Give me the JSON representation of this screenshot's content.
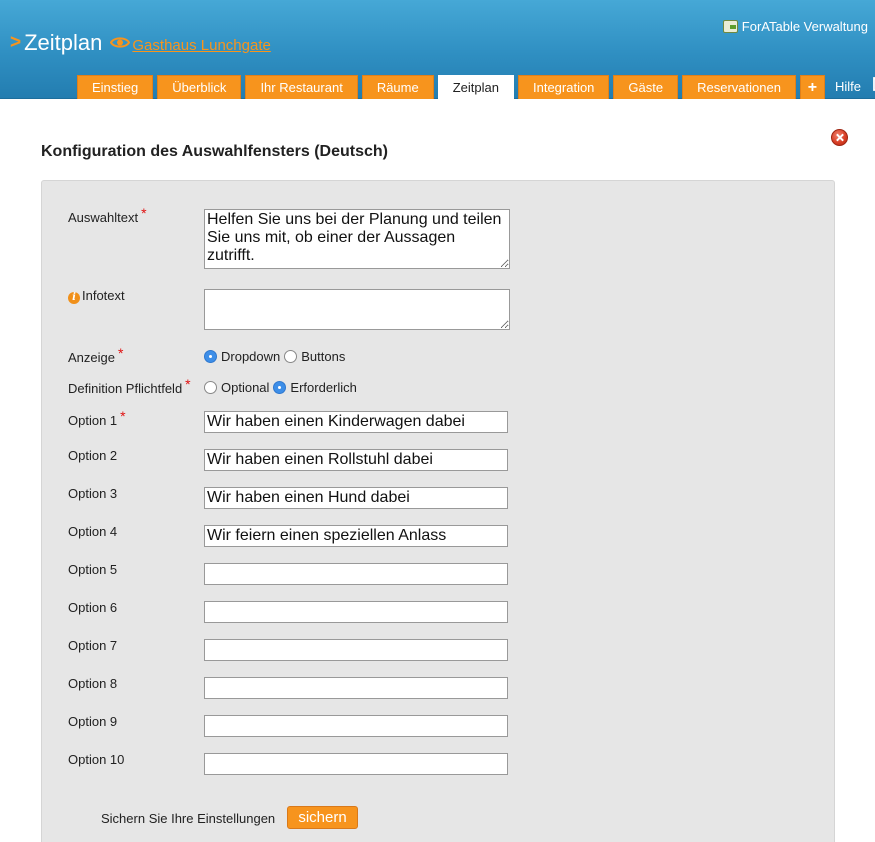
{
  "header": {
    "chevron": ">",
    "title": "Zeitplan",
    "restaurant": "Gasthaus Lunchgate",
    "admin_label": "ForATable Verwaltung"
  },
  "nav": {
    "tabs": [
      "Einstieg",
      "Überblick",
      "Ihr Restaurant",
      "Räume",
      "Zeitplan",
      "Integration",
      "Gäste",
      "Reservationen"
    ],
    "active": "Zeitplan",
    "plus": "+",
    "help": "Hilfe"
  },
  "page": {
    "title": "Konfiguration des Auswahlfensters (Deutsch)"
  },
  "form": {
    "selection_text_label": "Auswahltext",
    "selection_text_value": "Helfen Sie uns bei der Planung und teilen Sie uns mit, ob einer der Aussagen zutrifft.",
    "info_text_label": "Infotext",
    "info_text_value": "",
    "display_label": "Anzeige",
    "display_options": [
      "Dropdown",
      "Buttons"
    ],
    "display_selected": "Dropdown",
    "required_label": "Definition Pflichtfeld",
    "required_options": [
      "Optional",
      "Erforderlich"
    ],
    "required_selected": "Erforderlich",
    "required_mark": "*",
    "options": [
      {
        "label": "Option 1",
        "value": "Wir haben einen Kinderwagen dabei"
      },
      {
        "label": "Option 2",
        "value": "Wir haben einen Rollstuhl dabei"
      },
      {
        "label": "Option 3",
        "value": "Wir haben einen Hund dabei"
      },
      {
        "label": "Option 4",
        "value": "Wir feiern einen speziellen Anlass"
      },
      {
        "label": "Option 5",
        "value": ""
      },
      {
        "label": "Option 6",
        "value": ""
      },
      {
        "label": "Option 7",
        "value": ""
      },
      {
        "label": "Option 8",
        "value": ""
      },
      {
        "label": "Option 9",
        "value": ""
      },
      {
        "label": "Option 10",
        "value": ""
      }
    ],
    "save_text": "Sichern Sie Ihre Einstellungen",
    "save_button": "sichern"
  },
  "colors": {
    "accent": "#f7941d",
    "header_blue": "#2f8fc2",
    "required_red": "#e01010",
    "radio_blue": "#3d8ee8"
  },
  "icons": [
    "eye-icon",
    "admin-icon",
    "mail-icon",
    "close-icon",
    "info-icon"
  ]
}
